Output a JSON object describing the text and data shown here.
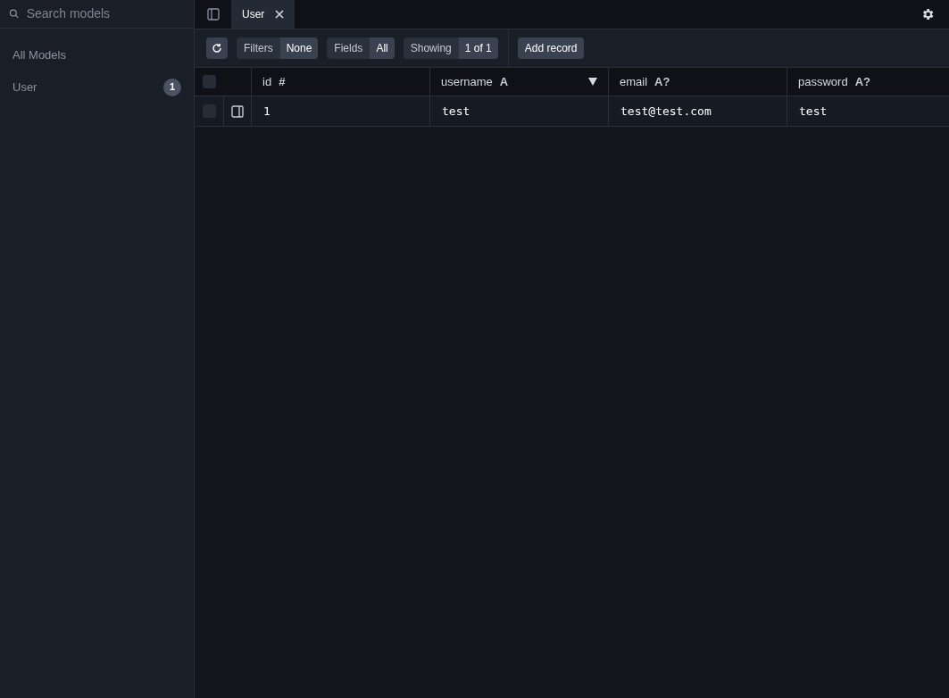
{
  "sidebar": {
    "search": {
      "placeholder": "Search models"
    },
    "heading": "All Models",
    "items": [
      {
        "label": "User",
        "count": "1",
        "selected": false
      }
    ]
  },
  "tabs": [
    {
      "label": "User",
      "selected": true
    }
  ],
  "toolbar": {
    "groups": [
      {
        "label": "Filters",
        "value": "None"
      },
      {
        "label": "Fields",
        "value": "All"
      },
      {
        "label": "Showing",
        "value": "1 of 1"
      }
    ],
    "add_button": "Add record"
  },
  "table": {
    "all_checked": false,
    "columns": [
      {
        "name": "id",
        "type": "#",
        "sorted": false
      },
      {
        "name": "username",
        "type": "A",
        "sorted": true
      },
      {
        "name": "email",
        "type": "A?",
        "sorted": false
      },
      {
        "name": "password",
        "type": "A?",
        "sorted": false
      }
    ],
    "rows": [
      {
        "checked": false,
        "cells": [
          "1",
          "test",
          "test@test.com",
          "test"
        ]
      }
    ]
  }
}
